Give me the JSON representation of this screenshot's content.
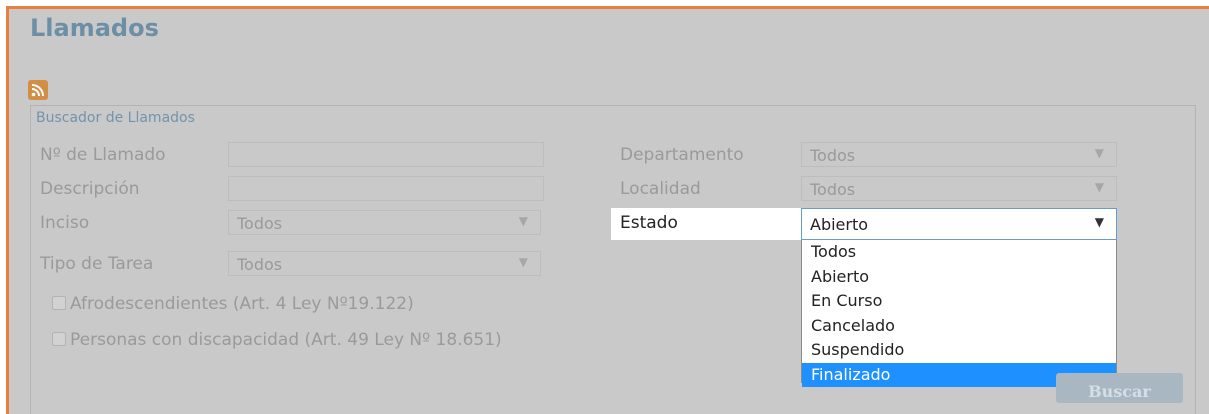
{
  "page": {
    "title": "Llamados",
    "rss_icon": "rss-icon"
  },
  "search": {
    "legend": "Buscador de Llamados",
    "fields": {
      "numero_label": "Nº de Llamado",
      "numero_value": "",
      "descripcion_label": "Descripción",
      "descripcion_value": "",
      "inciso_label": "Inciso",
      "inciso_value": "Todos",
      "tipo_label": "Tipo de Tarea",
      "tipo_value": "Todos",
      "departamento_label": "Departamento",
      "departamento_value": "Todos",
      "localidad_label": "Localidad",
      "localidad_value": "Todos",
      "estado_label": "Estado",
      "estado_value": "Abierto"
    },
    "checkboxes": {
      "afro_label": "Afrodescendientes (Art. 4 Ley Nº19.122)",
      "discapacidad_label": "Personas con discapacidad (Art. 49 Ley Nº 18.651)"
    },
    "estado_options": [
      "Todos",
      "Abierto",
      "En Curso",
      "Cancelado",
      "Suspendido",
      "Finalizado"
    ],
    "estado_highlighted": "Finalizado",
    "submit_label": "Buscar"
  },
  "colors": {
    "accent": "#e87f3e",
    "title": "#6d8fa6",
    "highlight": "#1e90ff"
  }
}
